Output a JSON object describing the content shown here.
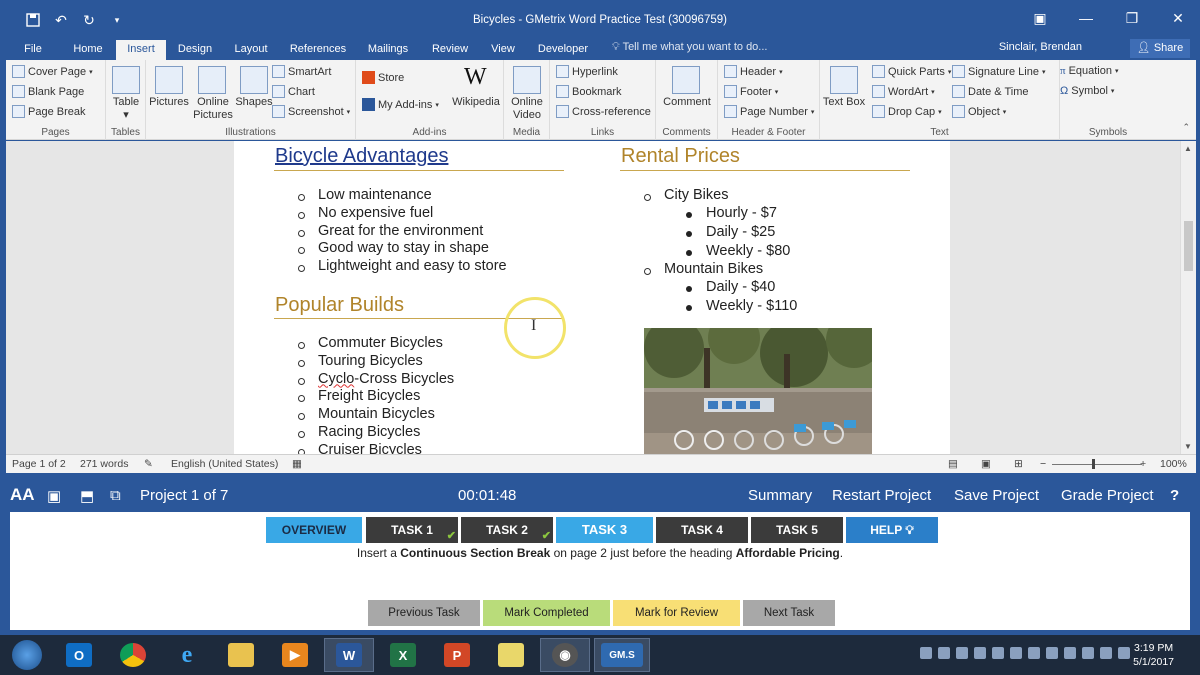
{
  "window": {
    "title": "Bicycles -  GMetrix Word Practice Test (30096759)"
  },
  "ribbon_tabs": [
    "File",
    "Home",
    "Insert",
    "Design",
    "Layout",
    "References",
    "Mailings",
    "Review",
    "View",
    "Developer"
  ],
  "active_tab": "Insert",
  "tell_me": "Tell me what you want to do...",
  "account": "Sinclair, Brendan",
  "share_label": "Share",
  "ribbon": {
    "pages": {
      "label": "Pages",
      "items": [
        "Cover Page",
        "Blank Page",
        "Page Break"
      ]
    },
    "tables": {
      "label": "Tables",
      "item": "Table"
    },
    "illustrations": {
      "label": "Illustrations",
      "pictures": "Pictures",
      "online_pictures": "Online Pictures",
      "shapes": "Shapes",
      "smartart": "SmartArt",
      "chart": "Chart",
      "screenshot": "Screenshot"
    },
    "addins": {
      "label": "Add-ins",
      "store": "Store",
      "my_addins": "My Add-ins",
      "wikipedia": "Wikipedia"
    },
    "media": {
      "label": "Media",
      "online_video": "Online Video"
    },
    "links": {
      "label": "Links",
      "hyperlink": "Hyperlink",
      "bookmark": "Bookmark",
      "cross_reference": "Cross-reference"
    },
    "comments": {
      "label": "Comments",
      "comment": "Comment"
    },
    "header_footer": {
      "label": "Header & Footer",
      "header": "Header",
      "footer": "Footer",
      "page_number": "Page Number"
    },
    "text": {
      "label": "Text",
      "text_box": "Text Box",
      "quick_parts": "Quick Parts",
      "wordart": "WordArt",
      "drop_cap": "Drop Cap",
      "signature_line": "Signature Line",
      "date_time": "Date & Time",
      "object": "Object"
    },
    "symbols": {
      "label": "Symbols",
      "equation": "Equation",
      "symbol": "Symbol"
    }
  },
  "document": {
    "left": {
      "heading1": "Bicycle Advantages",
      "list1": [
        "Low maintenance",
        "No expensive fuel",
        "Great for the environment",
        "Good way to stay in shape",
        "Lightweight and easy to store"
      ],
      "heading2": "Popular Builds",
      "list2": [
        "Commuter Bicycles",
        "Touring Bicycles",
        "Cyclo-Cross Bicycles",
        "Freight Bicycles",
        "Mountain Bicycles",
        "Racing Bicycles",
        "Cruiser Bicycles"
      ]
    },
    "right": {
      "heading": "Rental Prices",
      "city": "City Bikes",
      "city_prices": [
        "Hourly - $7",
        "Daily - $25",
        "Weekly - $80"
      ],
      "mountain": "Mountain Bikes",
      "mountain_prices": [
        "Daily - $40",
        "Weekly - $110"
      ]
    }
  },
  "status": {
    "page": "Page 1 of 2",
    "words": "271 words",
    "language": "English (United States)",
    "zoom": "100%"
  },
  "gmetrix": {
    "project": "Project 1 of 7",
    "timer": "00:01:48",
    "summary": "Summary",
    "restart": "Restart Project",
    "save": "Save Project",
    "grade": "Grade Project",
    "help_q": "?",
    "tabs": [
      "OVERVIEW",
      "TASK 1",
      "TASK 2",
      "TASK 3",
      "TASK 4",
      "TASK 5",
      "HELP"
    ],
    "instruction": {
      "pre": "Insert a ",
      "bold1": "Continuous Section Break",
      "mid": " on page 2 just before the heading ",
      "bold2": "Affordable Pricing",
      "post": "."
    },
    "buttons": {
      "previous": "Previous Task",
      "completed": "Mark Completed",
      "review": "Mark for Review",
      "next": "Next Task"
    },
    "colors": {
      "overview": "#39a8e6",
      "task_done": "#3b3b3b",
      "task_current": "#39a8e6",
      "help": "#2b7fc9",
      "completed": "#b9dc7a",
      "review": "#f8df75",
      "gray": "#a8a8a8"
    }
  },
  "taskbar": {
    "time": "3:19 PM",
    "date": "5/1/2017",
    "gm_label": "GM.S"
  }
}
